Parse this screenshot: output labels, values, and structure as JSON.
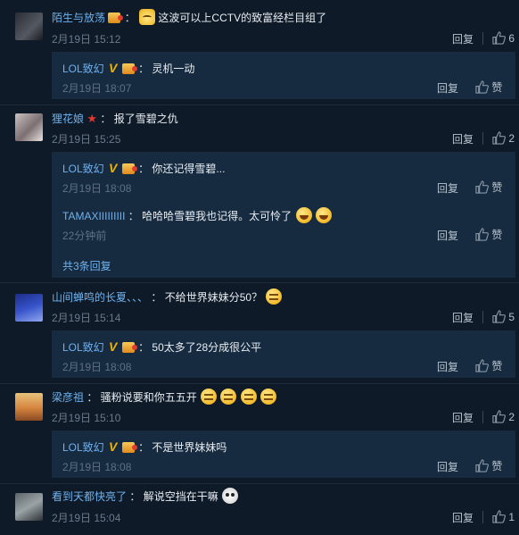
{
  "reply_label": "回复",
  "like_label": "赞",
  "comments": [
    {
      "user": "陌生与放荡",
      "text": "这波可以上CCTV的致富经栏目组了",
      "time": "2月19日 15:12",
      "likes": "6",
      "emojis": [
        "cat-emoji"
      ],
      "replies": [
        {
          "user": "LOL致幻",
          "text": "灵机一动",
          "time": "2月19日 18:07"
        }
      ]
    },
    {
      "user": "狸花娘",
      "text": "报了雪碧之仇",
      "time": "2月19日 15:25",
      "likes": "2",
      "replies": [
        {
          "user": "LOL致幻",
          "text": "你还记得雪碧...",
          "time": "2月19日 18:08"
        },
        {
          "user": "TAMAXIIIIIIIII",
          "text": "哈哈哈雪碧我也记得。太可怜了",
          "time": "22分钟前"
        }
      ],
      "more_replies": "共3条回复"
    },
    {
      "user": "山间蝉鸣的长夏、、、",
      "text": "不给世界妹妹分50？",
      "time": "2月19日 15:14",
      "likes": "5",
      "replies": [
        {
          "user": "LOL致幻",
          "text": "50太多了28分成很公平",
          "time": "2月19日 18:08"
        }
      ]
    },
    {
      "user": "梁彦祖",
      "text": "骚粉说要和你五五开",
      "time": "2月19日 15:10",
      "likes": "2",
      "replies": [
        {
          "user": "LOL致幻",
          "text": "不是世界妹妹吗",
          "time": "2月19日 18:08"
        }
      ]
    },
    {
      "user": "看到天都快亮了",
      "text": "解说空挡在干嘛",
      "time": "2月19日 15:04",
      "likes": "1",
      "replies": []
    }
  ],
  "colors": {
    "background": "#0e1a28",
    "subpanel": "#162a40",
    "username": "#6fb2ee",
    "timestamp": "#6a7a8a",
    "vip_badge": "#f0b400"
  }
}
